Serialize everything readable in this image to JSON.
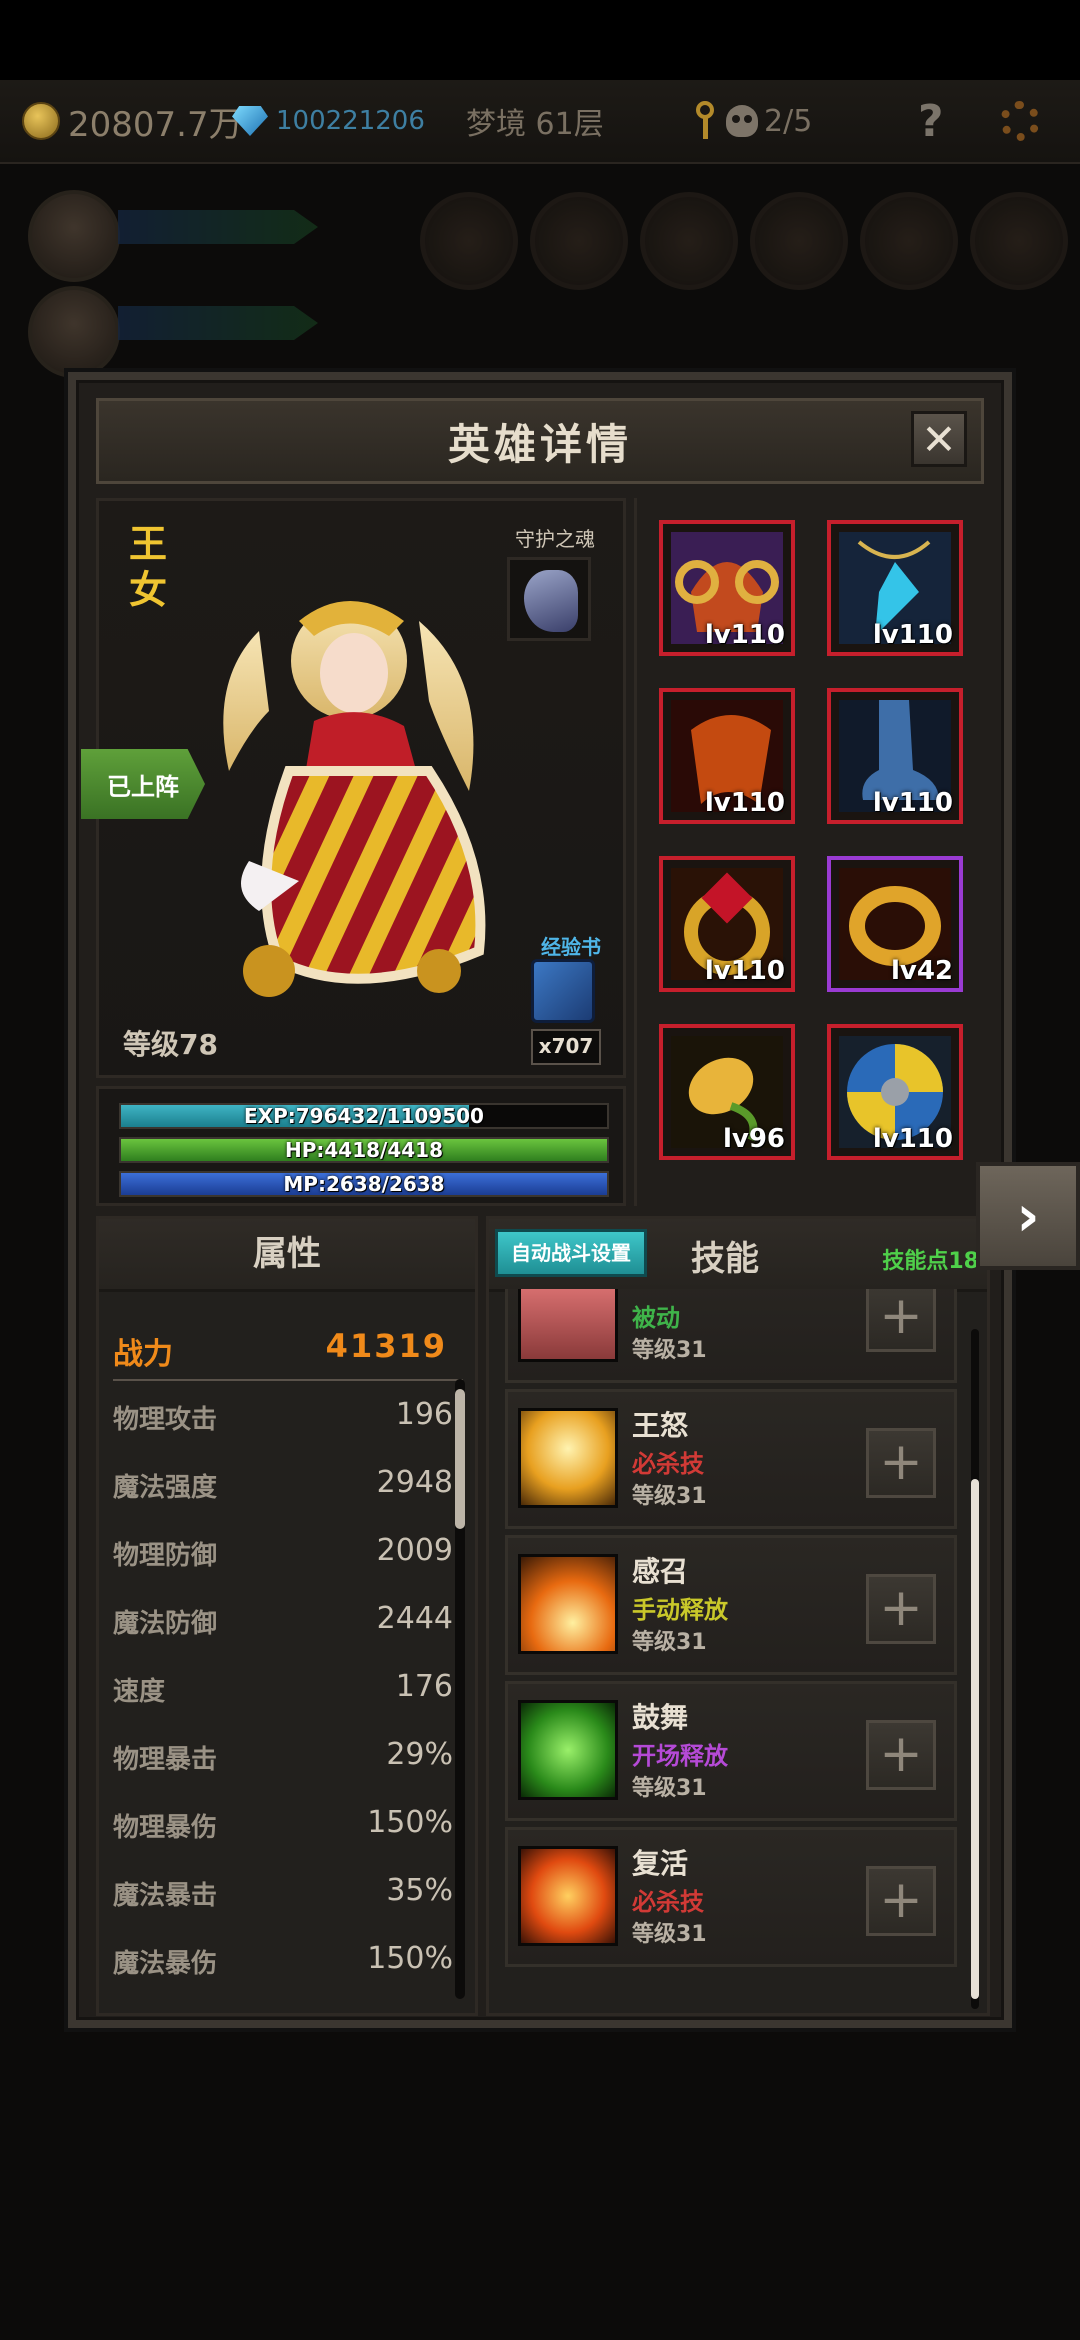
{
  "topbar": {
    "gold": "20807.7万",
    "gems": "100221206",
    "floor": "梦境 61层",
    "keys_label": "2/5",
    "help": "?"
  },
  "dialog": {
    "title": "英雄详情",
    "close": "✕"
  },
  "hero": {
    "name": "王女",
    "guard_label": "守护之魂",
    "deployed": "已上阵",
    "level": "等级78",
    "book_label": "经验书",
    "book_count": "x707",
    "exp": "EXP:796432/1109500",
    "exp_ratio": 0.717,
    "hp": "HP:4418/4418",
    "hp_ratio": 1.0,
    "mp": "MP:2638/2638",
    "mp_ratio": 1.0
  },
  "equipment": [
    {
      "name": "helmet-icon",
      "level": "lv110",
      "rarity": "red"
    },
    {
      "name": "pendant-icon",
      "level": "lv110",
      "rarity": "red"
    },
    {
      "name": "cloak-icon",
      "level": "lv110",
      "rarity": "red"
    },
    {
      "name": "boots-icon",
      "level": "lv110",
      "rarity": "red"
    },
    {
      "name": "ruby-ring-icon",
      "level": "lv110",
      "rarity": "red"
    },
    {
      "name": "gold-ring-icon",
      "level": "lv42",
      "rarity": "purple"
    },
    {
      "name": "seed-icon",
      "level": "lv96",
      "rarity": "red"
    },
    {
      "name": "shield-icon",
      "level": "lv110",
      "rarity": "red"
    }
  ],
  "attributes": {
    "tab": "属性",
    "power_label": "战力",
    "power_value": "41319",
    "rows": [
      {
        "k": "物理攻击",
        "v": "196"
      },
      {
        "k": "魔法强度",
        "v": "2948"
      },
      {
        "k": "物理防御",
        "v": "2009"
      },
      {
        "k": "魔法防御",
        "v": "2444"
      },
      {
        "k": "速度",
        "v": "176"
      },
      {
        "k": "物理暴击",
        "v": "29%"
      },
      {
        "k": "物理暴伤",
        "v": "150%"
      },
      {
        "k": "魔法暴击",
        "v": "35%"
      },
      {
        "k": "魔法暴伤",
        "v": "150%"
      }
    ]
  },
  "skills": {
    "auto_button": "自动战斗设置",
    "tab": "技能",
    "points": "技能点18",
    "items": [
      {
        "name": "",
        "type": "被动",
        "type_color": "#3fb44a",
        "level": "等级31",
        "icon": "passive-skill-icon"
      },
      {
        "name": "王怒",
        "type": "必杀技",
        "type_color": "#d23a36",
        "level": "等级31",
        "icon": "kings-wrath-skill-icon"
      },
      {
        "name": "感召",
        "type": "手动释放",
        "type_color": "#c9c82a",
        "level": "等级31",
        "icon": "summon-skill-icon"
      },
      {
        "name": "鼓舞",
        "type": "开场释放",
        "type_color": "#b54ad6",
        "level": "等级31",
        "icon": "inspire-skill-icon"
      },
      {
        "name": "复活",
        "type": "必杀技",
        "type_color": "#d23a36",
        "level": "等级31",
        "icon": "revive-skill-icon"
      }
    ]
  },
  "next_arrow": "›"
}
